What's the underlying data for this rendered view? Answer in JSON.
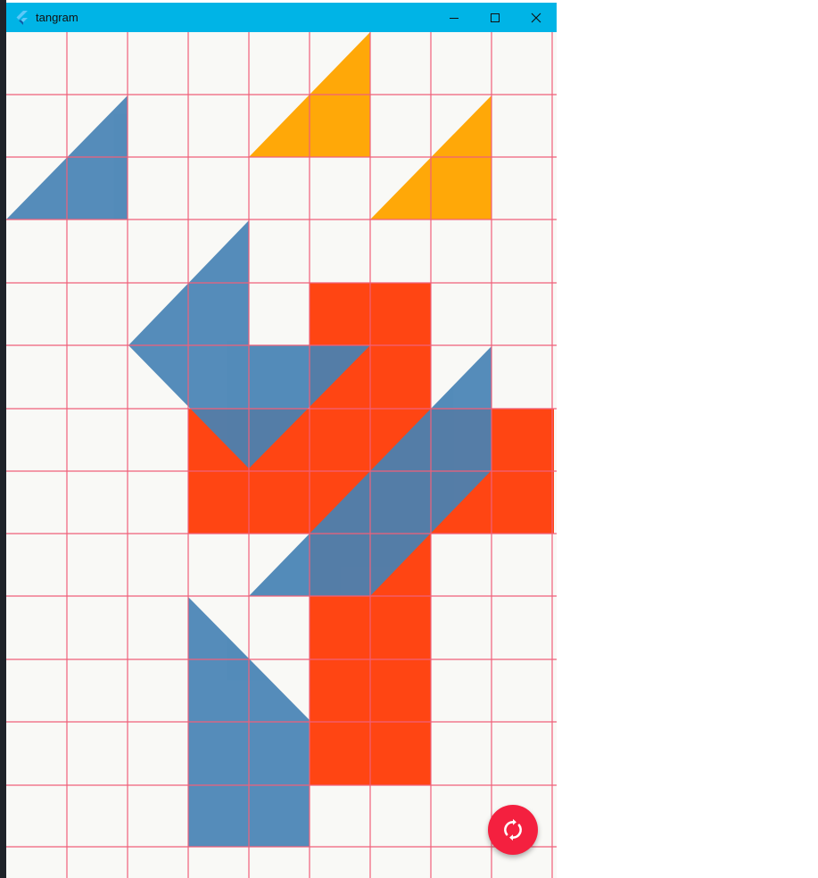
{
  "window": {
    "title": "tangram",
    "minimize_icon": "minimize-icon",
    "maximize_icon": "maximize-icon",
    "close_icon": "close-icon"
  },
  "colors": {
    "titlebar": "#00b4e6",
    "background": "#f9f9f6",
    "grid_line": "#f0607a",
    "blue_piece": "#4682b4",
    "orange_piece": "#ffa500",
    "red_piece": "#ff4513",
    "fab": "#f4203f"
  },
  "fab": {
    "icon": "refresh-icon"
  }
}
